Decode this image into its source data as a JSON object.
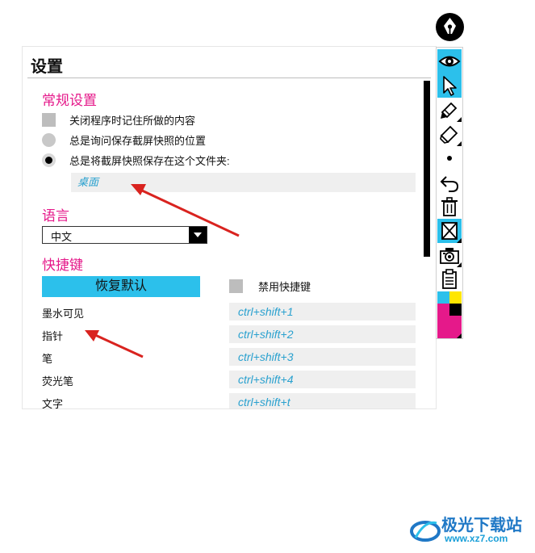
{
  "settings": {
    "title": "设置",
    "general": {
      "heading": "常规设置",
      "options": [
        {
          "label": "关闭程序时记住所做的内容",
          "type": "checkbox",
          "checked": false
        },
        {
          "label": "总是询问保存截屏快照的位置",
          "type": "radio",
          "checked": false
        },
        {
          "label": "总是将截屏快照保存在这个文件夹:",
          "type": "radio",
          "checked": true
        }
      ],
      "folder": "桌面"
    },
    "language": {
      "heading": "语言",
      "selected": "中文"
    },
    "hotkeys": {
      "heading": "快捷键",
      "restore_label": "恢复默认",
      "disable_label": "禁用快捷键",
      "items": [
        {
          "label": "墨水可见",
          "keys": "ctrl+shift+1"
        },
        {
          "label": "指针",
          "keys": "ctrl+shift+2"
        },
        {
          "label": "笔",
          "keys": "ctrl+shift+3"
        },
        {
          "label": "荧光笔",
          "keys": "ctrl+shift+4"
        },
        {
          "label": "文字",
          "keys": "ctrl+shift+t"
        }
      ]
    }
  },
  "toolbar": {
    "tools": [
      "eye-icon",
      "pointer-icon",
      "pen-icon",
      "highlighter-icon",
      "dot-icon",
      "undo-icon",
      "trash-icon",
      "clear-screen-icon",
      "camera-icon",
      "clipboard-icon",
      "color-palette"
    ],
    "accent_color": "#2cc0eb",
    "palette": [
      "#2cc0eb",
      "#ffe600",
      "#e5198a",
      "#000000"
    ]
  },
  "watermark": {
    "brand": "极光下载站",
    "url": "www.xz7.com"
  },
  "colors": {
    "heading": "#e5198a",
    "accent": "#2cc0eb",
    "field_text": "#2aa1cf",
    "annotation_arrow": "#d9231f"
  }
}
